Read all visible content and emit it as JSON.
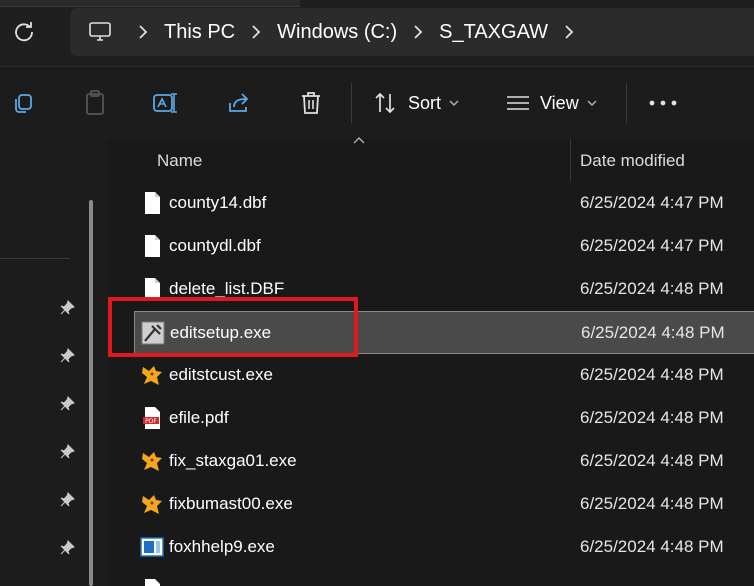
{
  "address": {
    "segments": [
      "This PC",
      "Windows (C:)",
      "S_TAXGAW"
    ]
  },
  "toolbar": {
    "sort_label": "Sort",
    "view_label": "View"
  },
  "columns": {
    "name": "Name",
    "date_modified": "Date modified"
  },
  "files": [
    {
      "name": "county14.dbf",
      "date": "6/25/2024 4:47 PM",
      "icon": "document-icon"
    },
    {
      "name": "countydl.dbf",
      "date": "6/25/2024 4:47 PM",
      "icon": "document-icon"
    },
    {
      "name": "delete_list.DBF",
      "date": "6/25/2024 4:48 PM",
      "icon": "document-icon"
    },
    {
      "name": "editsetup.exe",
      "date": "6/25/2024 4:48 PM",
      "icon": "setup-exe-icon"
    },
    {
      "name": "editstcust.exe",
      "date": "6/25/2024 4:48 PM",
      "icon": "foxpro-app-icon"
    },
    {
      "name": "efile.pdf",
      "date": "6/25/2024 4:48 PM",
      "icon": "pdf-icon"
    },
    {
      "name": "fix_staxga01.exe",
      "date": "6/25/2024 4:48 PM",
      "icon": "foxpro-app-icon"
    },
    {
      "name": "fixbumast00.exe",
      "date": "6/25/2024 4:48 PM",
      "icon": "foxpro-app-icon"
    },
    {
      "name": "foxhhelp9.exe",
      "date": "6/25/2024 4:48 PM",
      "icon": "help-exe-icon"
    }
  ],
  "colors": {
    "selection_highlight": "#e1191e",
    "background": "#191919"
  }
}
